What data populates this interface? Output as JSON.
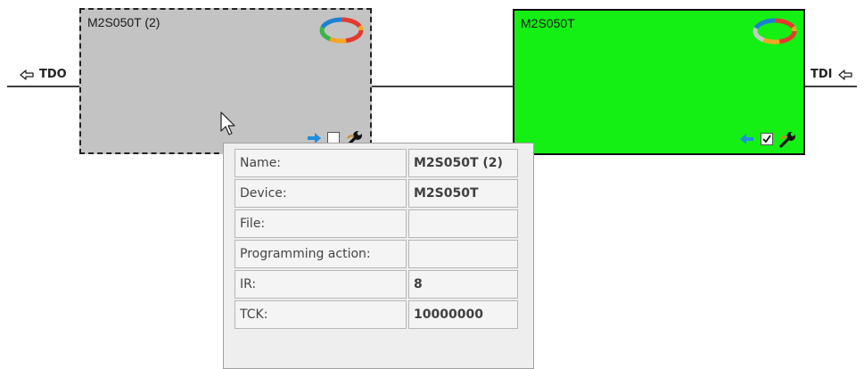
{
  "ports": {
    "left_label": "TDO",
    "right_label": "TDI"
  },
  "devices": [
    {
      "title": "M2S050T (2)",
      "state": "selected",
      "background": "#c3c3c3",
      "checkbox_checked": false,
      "arrow_direction": "right",
      "logo_icon": "microsemi-logo",
      "settings_icon": "wrench-icon"
    },
    {
      "title": "M2S050T",
      "state": "programmed",
      "background": "#14f014",
      "checkbox_checked": true,
      "arrow_direction": "left",
      "logo_icon": "microsemi-logo",
      "settings_icon": "wrench-icon"
    }
  ],
  "tooltip": {
    "rows": [
      {
        "key": "Name:",
        "value": "M2S050T (2)"
      },
      {
        "key": "Device:",
        "value": "M2S050T"
      },
      {
        "key": "File:",
        "value": ""
      },
      {
        "key": "Programming action:",
        "value": ""
      },
      {
        "key": "IR:",
        "value": "8"
      },
      {
        "key": "TCK:",
        "value": "10000000"
      }
    ]
  },
  "colors": {
    "arrow_blue": "#1f8de0",
    "chain_line": "#3d3d3d",
    "selected_device": "#c3c3c3",
    "active_device": "#14f014"
  }
}
